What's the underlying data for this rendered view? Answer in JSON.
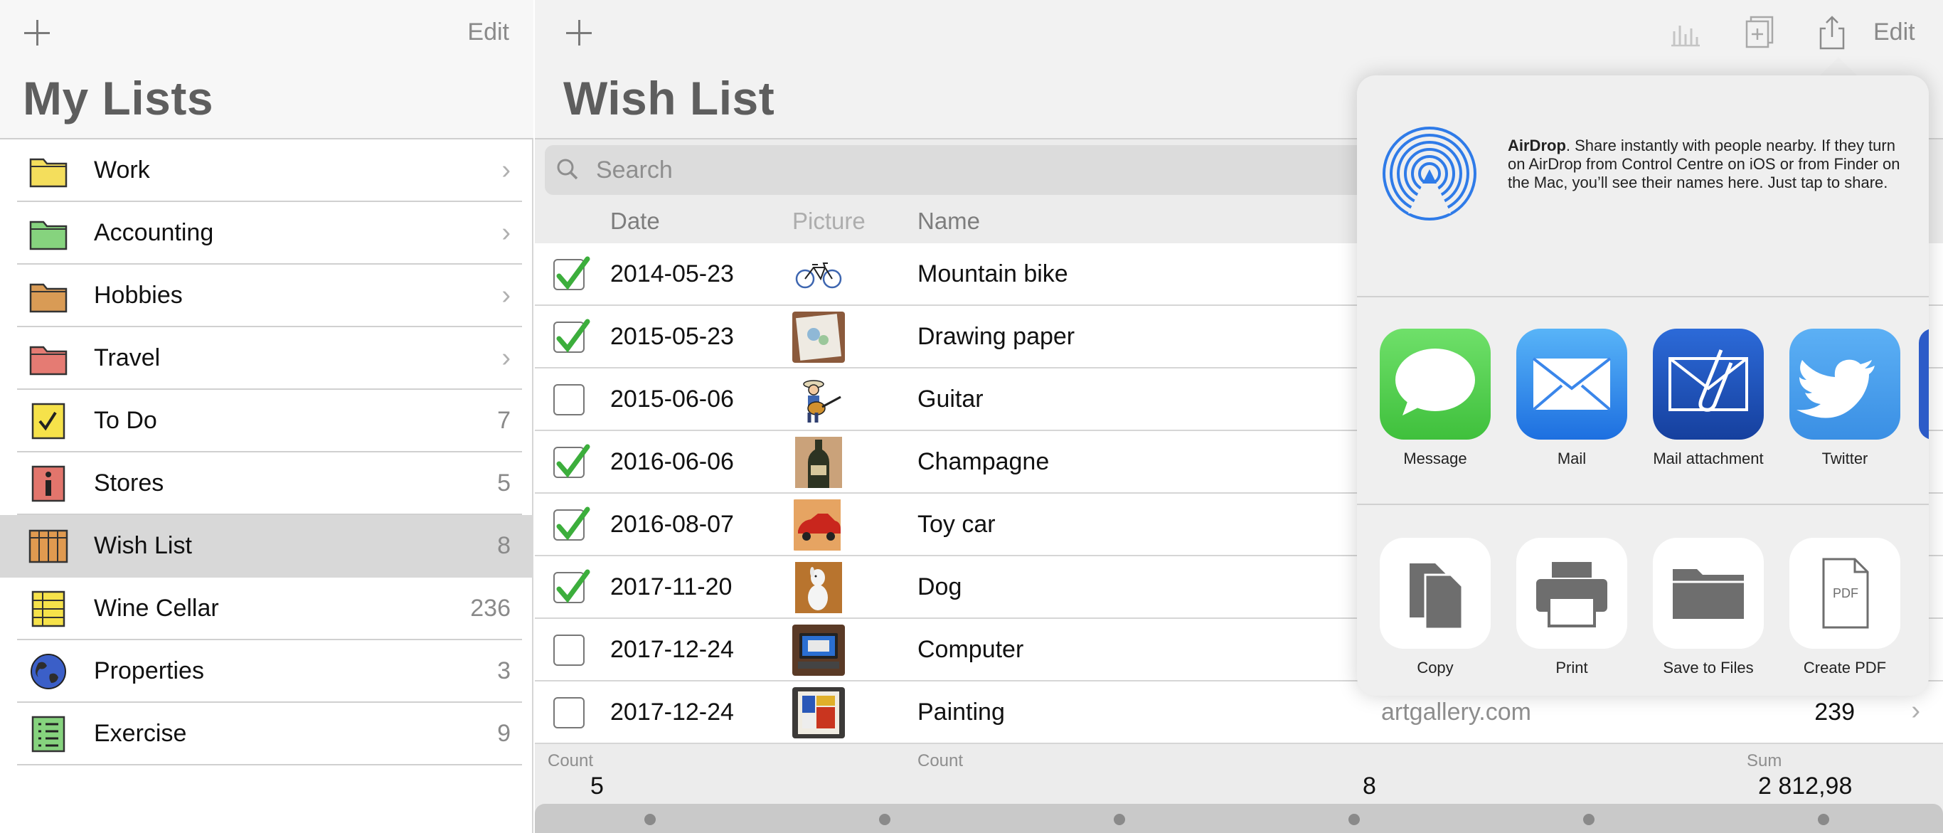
{
  "sidebar": {
    "title": "My Lists",
    "edit_label": "Edit",
    "items": [
      {
        "label": "Work",
        "icon": "folder-yellow-icon",
        "count": "",
        "chevron": true
      },
      {
        "label": "Accounting",
        "icon": "folder-green-icon",
        "count": "",
        "chevron": true
      },
      {
        "label": "Hobbies",
        "icon": "folder-orange-icon",
        "count": "",
        "chevron": true
      },
      {
        "label": "Travel",
        "icon": "folder-red-icon",
        "count": "",
        "chevron": true
      },
      {
        "label": "To Do",
        "icon": "checkbox-list-icon",
        "count": "7",
        "chevron": false
      },
      {
        "label": "Stores",
        "icon": "info-icon",
        "count": "5",
        "chevron": false
      },
      {
        "label": "Wish List",
        "icon": "grid-icon",
        "count": "8",
        "chevron": false,
        "selected": true
      },
      {
        "label": "Wine Cellar",
        "icon": "table-icon",
        "count": "236",
        "chevron": false
      },
      {
        "label": "Properties",
        "icon": "globe-icon",
        "count": "3",
        "chevron": false
      },
      {
        "label": "Exercise",
        "icon": "checklist-icon",
        "count": "9",
        "chevron": false
      }
    ]
  },
  "main": {
    "title": "Wish List",
    "edit_label": "Edit",
    "search_placeholder": "Search",
    "columns": {
      "date": "Date",
      "picture": "Picture",
      "name": "Name"
    },
    "rows": [
      {
        "checked": true,
        "date": "2014-05-23",
        "name": "Mountain bike",
        "picture": "bicycle"
      },
      {
        "checked": true,
        "date": "2015-05-23",
        "name": "Drawing paper",
        "picture": "drawing-paper"
      },
      {
        "checked": false,
        "date": "2015-06-06",
        "name": "Guitar",
        "picture": "guitar-player"
      },
      {
        "checked": true,
        "date": "2016-06-06",
        "name": "Champagne",
        "picture": "champagne-bottle"
      },
      {
        "checked": true,
        "date": "2016-08-07",
        "name": "Toy car",
        "picture": "toy-car"
      },
      {
        "checked": true,
        "date": "2017-11-20",
        "name": "Dog",
        "picture": "dog-figurine"
      },
      {
        "checked": false,
        "date": "2017-12-24",
        "name": "Computer",
        "picture": "computer"
      },
      {
        "checked": false,
        "date": "2017-12-24",
        "name": "Painting",
        "picture": "painting",
        "link": "artgallery.com",
        "price": "239"
      }
    ],
    "footer": {
      "count1_label": "Count",
      "count1_value": "5",
      "count2_label": "Count",
      "count2_value": "8",
      "sum_label": "Sum",
      "sum_value": "2 812,98"
    }
  },
  "share_sheet": {
    "airdrop_title": "AirDrop",
    "airdrop_text": ". Share instantly with people nearby. If they turn on AirDrop from Control Centre on iOS or from Finder on the Mac, you’ll see their names here. Just tap to share.",
    "apps": [
      {
        "label": "Message",
        "icon": "message-icon",
        "color": "#5bd35a"
      },
      {
        "label": "Mail",
        "icon": "mail-icon",
        "color": "#2f8bf0"
      },
      {
        "label": "Mail attachment",
        "icon": "mail-attachment-icon",
        "color": "#1e56c8"
      },
      {
        "label": "Twitter",
        "icon": "twitter-icon",
        "color": "#4aa2ee"
      }
    ],
    "actions": [
      {
        "label": "Copy",
        "icon": "copy-icon"
      },
      {
        "label": "Print",
        "icon": "print-icon"
      },
      {
        "label": "Save to Files",
        "icon": "folder-icon"
      },
      {
        "label": "Create PDF",
        "icon": "pdf-icon"
      }
    ]
  },
  "colors": {
    "accent_check": "#3cae3c",
    "selected_row": "#d8d8d8"
  }
}
